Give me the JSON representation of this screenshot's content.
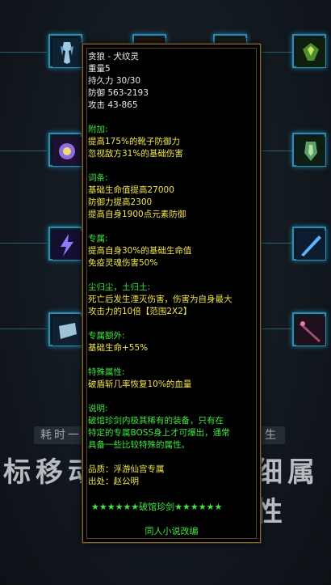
{
  "item": {
    "name": "贪狼 - 犬纹灵",
    "weight": "重量5",
    "durability": "持久力 30/30",
    "defense": "防御 563-2193",
    "attack": "攻击 43-865",
    "extra_header": "附加:",
    "extra_lines": [
      "提高175%的靴子防御力",
      "忽视敌方31%的基础伤害"
    ],
    "affix_header": "词条:",
    "affix_lines": [
      "基础生命值提高27000",
      "防御力提高2300",
      "提高自身1900点元素防御"
    ],
    "exclusive_header": "专属:",
    "exclusive_lines": [
      "提高自身30%的基础生命值",
      "免疫灵魂伤害50%"
    ],
    "dust_header": "尘归尘，土归土:",
    "dust_lines": [
      "死亡后发生湮灭伤害，伤害为自身最大",
      "攻击力的10倍【范围2X2】"
    ],
    "exclusive_extra_header": "专属额外:",
    "exclusive_extra_lines": [
      "基础生命+55%"
    ],
    "special_header": "特殊属性:",
    "special_lines": [
      "破盾斩几率恢复10%的血量"
    ],
    "desc_header": "说明:",
    "desc_lines": [
      "破馆珍剑内极其稀有的装备，只有在",
      "特定的专属BOSS身上才可爆出，通常",
      "具备一些比较特殊的属性。"
    ],
    "quality": "品质：浮游仙宫专属",
    "source": "出处：赵公明",
    "stars_label": "★★★★★★破馆珍剑★★★★★★",
    "footer": "同人小说改编"
  },
  "background": {
    "pill_left": "耗时一",
    "pill_right": "生",
    "big_left": "标移动",
    "big_right": "细属性"
  },
  "slots": [
    {
      "icon": "armor-figure-icon"
    },
    {
      "icon": "red-helm-icon"
    },
    {
      "icon": "helm-icon"
    },
    {
      "icon": "green-gem-icon"
    },
    {
      "icon": "orb-icon"
    },
    {
      "icon": "green-armor-icon"
    },
    {
      "icon": "lightning-icon"
    },
    {
      "icon": "blue-blade-icon"
    },
    {
      "icon": "bracer-icon"
    },
    {
      "icon": "staff-icon"
    }
  ]
}
